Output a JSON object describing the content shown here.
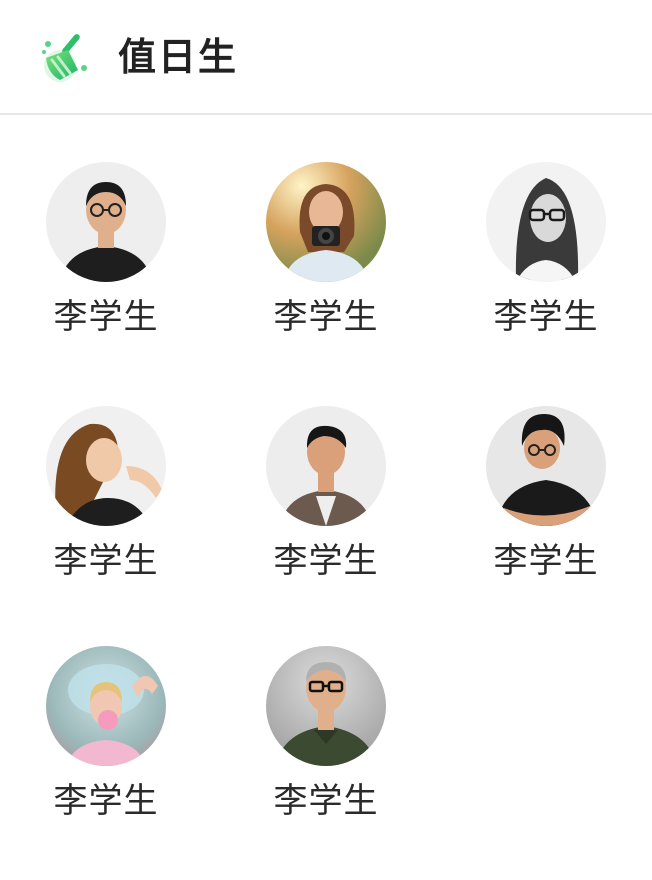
{
  "header": {
    "title": "值日生",
    "icon": "broom-icon",
    "accent": "#35c463"
  },
  "students": [
    {
      "name": "李学生",
      "bg": "#eeeeee",
      "skin": "#e0b08c",
      "hair": "#1b1b1b",
      "shirt": "#1e1e1e",
      "glasses": true
    },
    {
      "name": "李学生",
      "bg": "#c99a58",
      "skin": "#e8b896",
      "hair": "#7a4a2a",
      "shirt": "#dfe9f2",
      "glasses": false
    },
    {
      "name": "李学生",
      "bg": "#f2f2f2",
      "skin": "#d9d9d9",
      "hair": "#3a3a3a",
      "shirt": "#f5f5f5",
      "glasses": true
    },
    {
      "name": "李学生",
      "bg": "#f0f0f0",
      "skin": "#f0c9a8",
      "hair": "#7a4a22",
      "shirt": "#1e1e1e",
      "glasses": false
    },
    {
      "name": "李学生",
      "bg": "#ededed",
      "skin": "#d9a07a",
      "hair": "#161616",
      "shirt": "#6b5a4d",
      "glasses": false
    },
    {
      "name": "李学生",
      "bg": "#e7e7e7",
      "skin": "#d9a07a",
      "hair": "#161616",
      "shirt": "#1a1a1a",
      "glasses": true
    },
    {
      "name": "李学生",
      "bg": "#9ab7b8",
      "skin": "#f0c7b2",
      "hair": "#e5c37a",
      "shirt": "#f2b8d0",
      "glasses": false
    },
    {
      "name": "李学生",
      "bg": "#b9b9b9",
      "skin": "#e0b08c",
      "hair": "#b0b0b0",
      "shirt": "#3d4a32",
      "glasses": true
    }
  ]
}
